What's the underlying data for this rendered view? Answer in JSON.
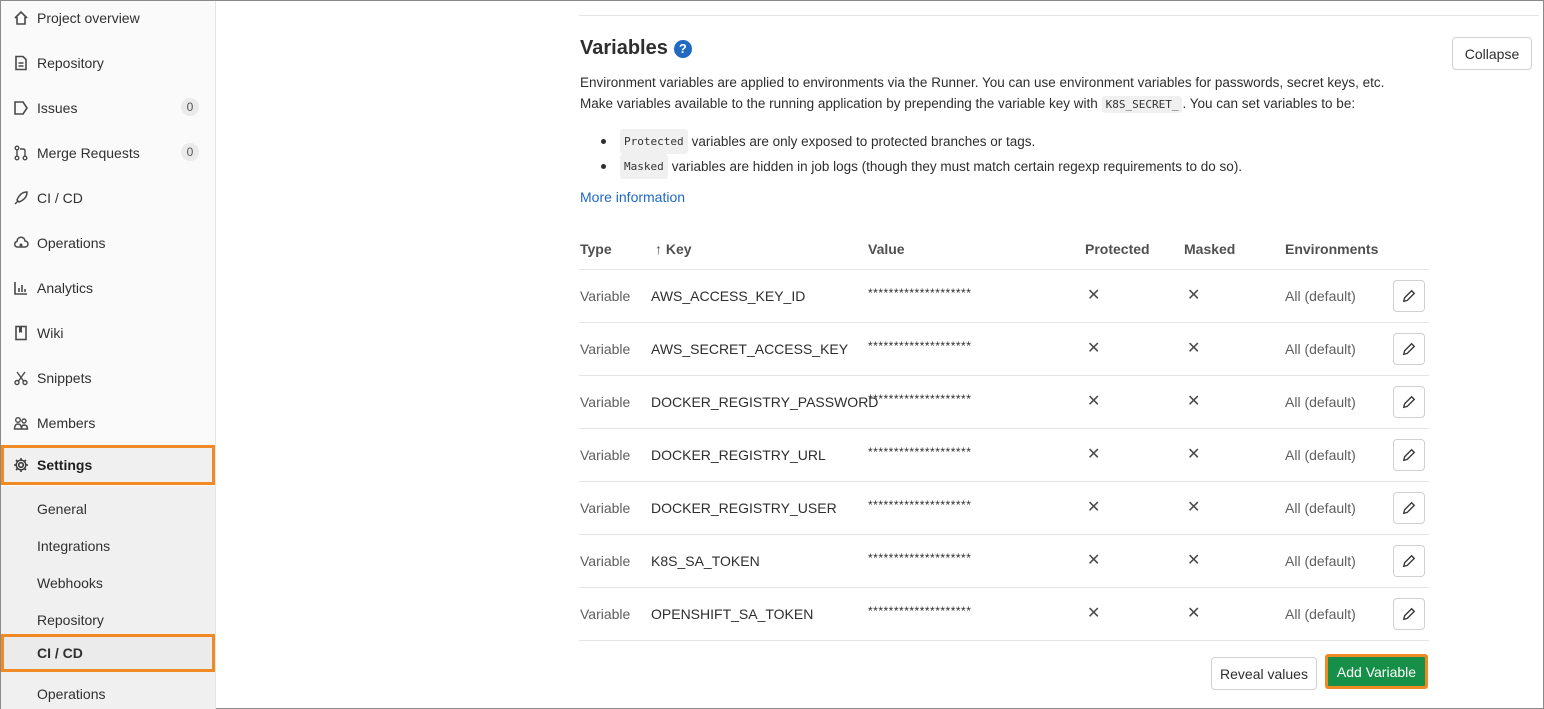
{
  "sidebar": {
    "items": [
      {
        "label": "Project overview",
        "icon": "home-icon"
      },
      {
        "label": "Repository",
        "icon": "doc-icon"
      },
      {
        "label": "Issues",
        "icon": "issues-icon",
        "count": "0"
      },
      {
        "label": "Merge Requests",
        "icon": "merge-request-icon",
        "count": "0"
      },
      {
        "label": "CI / CD",
        "icon": "rocket-icon"
      },
      {
        "label": "Operations",
        "icon": "cloud-gear-icon"
      },
      {
        "label": "Analytics",
        "icon": "chart-icon"
      },
      {
        "label": "Wiki",
        "icon": "book-icon"
      },
      {
        "label": "Snippets",
        "icon": "scissors-icon"
      },
      {
        "label": "Members",
        "icon": "users-icon"
      },
      {
        "label": "Settings",
        "icon": "gear-icon"
      }
    ],
    "settings_sub": [
      "General",
      "Integrations",
      "Webhooks",
      "Repository",
      "CI / CD",
      "Operations"
    ]
  },
  "section": {
    "title": "Variables",
    "help": "?",
    "collapse_label": "Collapse",
    "desc_line1": "Environment variables are applied to environments via the Runner. You can use environment variables for passwords, secret keys, etc.",
    "desc_line2_pre": "Make variables available to the running application by prepending the variable key with",
    "desc_line2_code": "K8S_SECRET_",
    "desc_line2_post": ". You can set variables to be:",
    "bullet1_code": "Protected",
    "bullet1_text": "variables are only exposed to protected branches or tags.",
    "bullet2_code": "Masked",
    "bullet2_text": "variables are hidden in job logs (though they must match certain regexp requirements to do so).",
    "more_link": "More information"
  },
  "table": {
    "headers": {
      "type": "Type",
      "key": "↑ Key",
      "value": "Value",
      "protected": "Protected",
      "masked": "Masked",
      "environments": "Environments"
    },
    "rows": [
      {
        "type": "Variable",
        "key": "AWS_ACCESS_KEY_ID",
        "value": "********************",
        "protected": "✕",
        "masked": "✕",
        "env": "All (default)"
      },
      {
        "type": "Variable",
        "key": "AWS_SECRET_ACCESS_KEY",
        "value": "********************",
        "protected": "✕",
        "masked": "✕",
        "env": "All (default)"
      },
      {
        "type": "Variable",
        "key": "DOCKER_REGISTRY_PASSWORD",
        "value": "********************",
        "protected": "✕",
        "masked": "✕",
        "env": "All (default)"
      },
      {
        "type": "Variable",
        "key": "DOCKER_REGISTRY_URL",
        "value": "********************",
        "protected": "✕",
        "masked": "✕",
        "env": "All (default)"
      },
      {
        "type": "Variable",
        "key": "DOCKER_REGISTRY_USER",
        "value": "********************",
        "protected": "✕",
        "masked": "✕",
        "env": "All (default)"
      },
      {
        "type": "Variable",
        "key": "K8S_SA_TOKEN",
        "value": "********************",
        "protected": "✕",
        "masked": "✕",
        "env": "All (default)"
      },
      {
        "type": "Variable",
        "key": "OPENSHIFT_SA_TOKEN",
        "value": "********************",
        "protected": "✕",
        "masked": "✕",
        "env": "All (default)"
      }
    ]
  },
  "actions": {
    "reveal_label": "Reveal values",
    "add_label": "Add Variable"
  },
  "colors": {
    "highlight": "#f08a24",
    "link": "#1f69c1",
    "add_button": "#168f48"
  }
}
